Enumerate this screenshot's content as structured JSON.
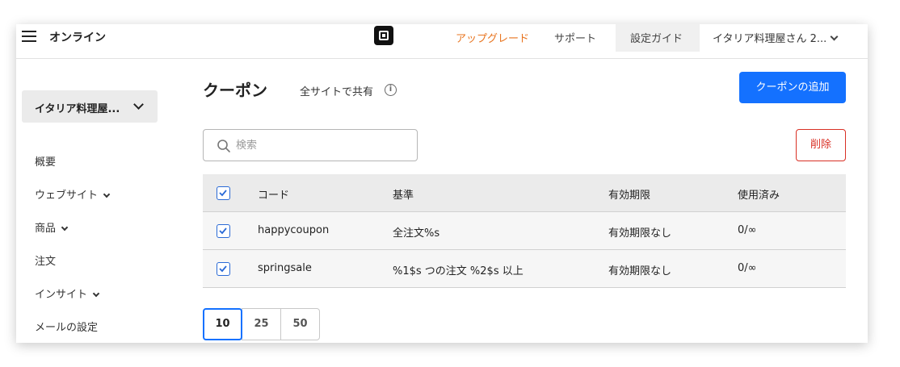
{
  "topbar": {
    "app_name": "オンライン",
    "nav": {
      "upgrade": "アップグレード",
      "support": "サポート",
      "setup_guide": "設定ガイド",
      "account": "イタリア料理屋さん 2..."
    }
  },
  "sidebar": {
    "site_selector": "イタリア料理屋...",
    "items": [
      {
        "label": "概要"
      },
      {
        "label": "ウェブサイト"
      },
      {
        "label": "商品"
      },
      {
        "label": "注文"
      },
      {
        "label": "インサイト"
      },
      {
        "label": "メールの設定"
      }
    ]
  },
  "main": {
    "title": "クーポン",
    "shared_label": "全サイトで共有",
    "add_button": "クーポンの追加",
    "search_placeholder": "検索",
    "delete_button": "削除",
    "table": {
      "headers": {
        "code": "コード",
        "basis": "基準",
        "expiry": "有効期限",
        "used": "使用済み"
      },
      "rows": [
        {
          "code": "happycoupon",
          "basis": "全注文%s",
          "expiry": "有効期限なし",
          "used": "0/∞"
        },
        {
          "code": "springsale",
          "basis": "%1$s つの注文 %2$s 以上",
          "expiry": "有効期限なし",
          "used": "0/∞"
        }
      ]
    },
    "pagination": [
      "10",
      "25",
      "50"
    ]
  },
  "colors": {
    "primary": "#1471ff",
    "upgrade": "#e8741f",
    "danger": "#d93025"
  }
}
